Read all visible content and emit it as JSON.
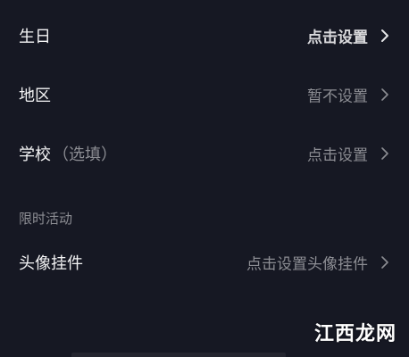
{
  "rows": {
    "birthday": {
      "label": "生日",
      "value": "点击设置"
    },
    "region": {
      "label": "地区",
      "value": "暂不设置"
    },
    "school": {
      "label": "学校",
      "hint": "（选填）",
      "value": "点击设置"
    },
    "pendant": {
      "label": "头像挂件",
      "value": "点击设置头像挂件"
    }
  },
  "section": {
    "title": "限时活动"
  },
  "watermark": "江西龙网",
  "colors": {
    "background": "#161823",
    "primary_text": "#f4f4f5",
    "secondary_text": "#8c8d93"
  },
  "icons": {
    "chevron": "chevron-right-icon"
  }
}
